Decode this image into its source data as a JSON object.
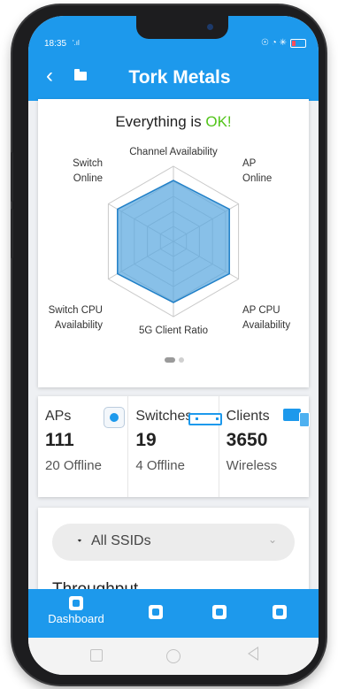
{
  "status_bar": {
    "time": "18:35",
    "signal": "⁺ᵢₐʟ",
    "icons": "☉ ◔ ✳"
  },
  "nav": {
    "back_icon": "chevron-left-icon",
    "title": "Tork Metals"
  },
  "health": {
    "message_prefix": "Everything is ",
    "status_word": "OK!",
    "status_color": "#52c41a"
  },
  "radar": {
    "labels": {
      "channel_availability": "Channel Availability",
      "ap_online_1": "AP",
      "ap_online_2": "Online",
      "ap_cpu_1": "AP CPU",
      "ap_cpu_2": "Availability",
      "client_ratio": "5G Client Ratio",
      "switch_cpu_1": "Switch CPU",
      "switch_cpu_2": "Availability",
      "switch_online_1": "Switch",
      "switch_online_2": "Online"
    },
    "fill_color": "#5aa7df"
  },
  "stats": [
    {
      "label": "APs",
      "value": "111",
      "sub": "20 Offline",
      "icon": "ap-icon"
    },
    {
      "label": "Switches",
      "value": "19",
      "sub": "4 Offline",
      "icon": "switch-icon"
    },
    {
      "label": "Clients",
      "value": "3650",
      "sub": "Wireless",
      "icon": "clients-icon"
    }
  ],
  "ssid": {
    "selected": "All SSIDs",
    "icon": "wifi-icon"
  },
  "section": {
    "throughput_title": "Throughput"
  },
  "tabbar": {
    "items": [
      {
        "label": "Dashboard",
        "icon": "dashboard-icon"
      },
      {
        "label": "",
        "icon": "devices-icon"
      },
      {
        "label": "",
        "icon": "clients-icon"
      },
      {
        "label": "",
        "icon": "favorites-icon"
      }
    ]
  },
  "colors": {
    "accent": "#1d99ec"
  }
}
